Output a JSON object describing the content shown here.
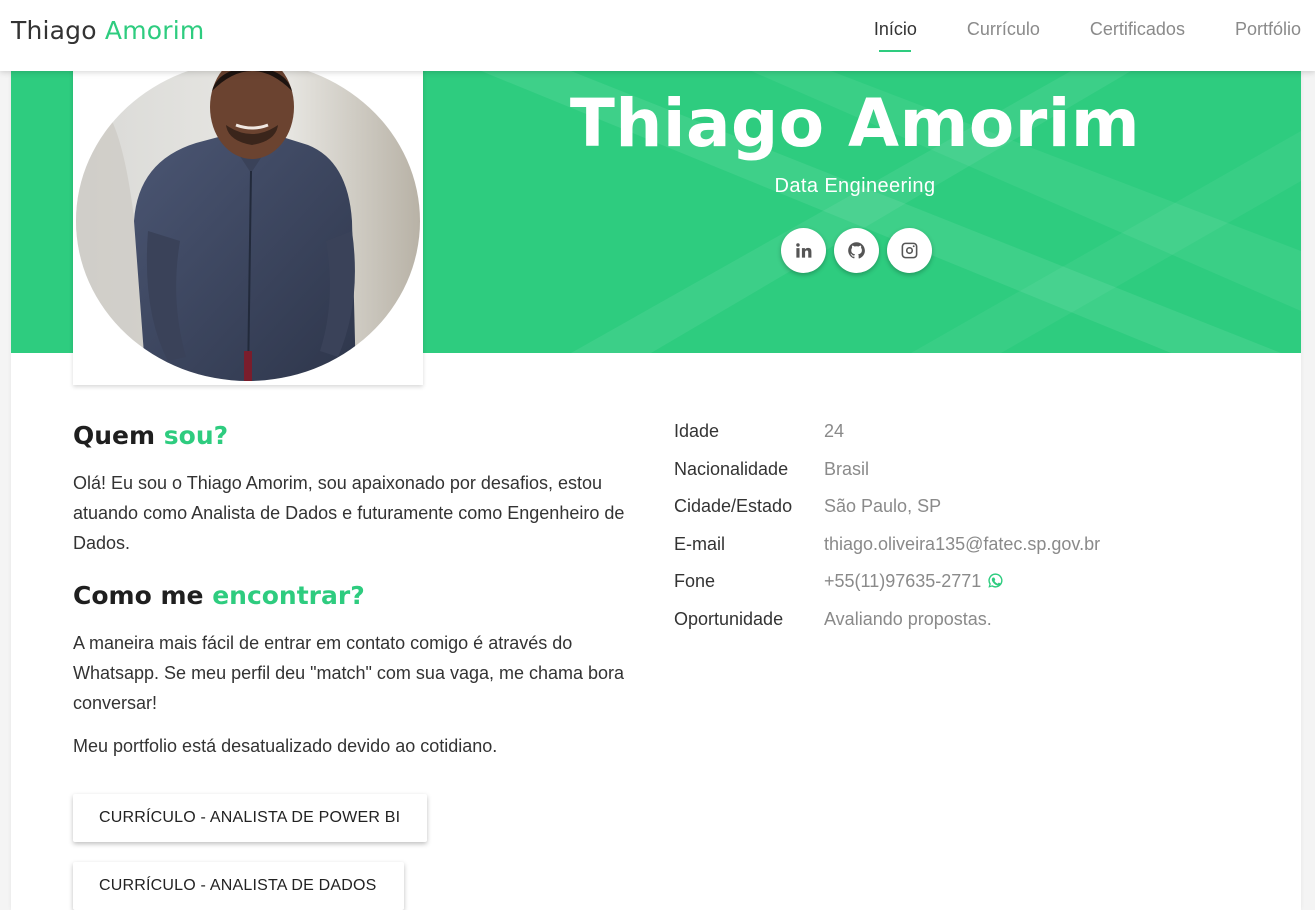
{
  "nav": {
    "brand_first": "Thiago",
    "brand_second": "Amorim",
    "links": [
      {
        "label": "Início",
        "active": true
      },
      {
        "label": "Currículo",
        "active": false
      },
      {
        "label": "Certificados",
        "active": false
      },
      {
        "label": "Portfólio",
        "active": false
      }
    ]
  },
  "hero": {
    "name": "Thiago Amorim",
    "role": "Data Engineering",
    "socials": [
      {
        "name": "linkedin-icon"
      },
      {
        "name": "github-icon"
      },
      {
        "name": "instagram-icon"
      }
    ]
  },
  "about": {
    "title_start": "Quem",
    "title_accent": "sou?",
    "text": "Olá! Eu sou o Thiago Amorim, sou apaixonado por desafios, estou atuando como Analista de Dados e futuramente como Engenheiro de Dados."
  },
  "contact": {
    "title_start": "Como me",
    "title_accent": "encontrar?",
    "text": "A maneira mais fácil de entrar em contato comigo é através do Whatsapp. Se meu perfil deu \"match\" com sua vaga, me chama bora conversar!",
    "note": "Meu portfolio está desatualizado devido ao cotidiano."
  },
  "buttons": {
    "cv_powerbi": "CURRÍCULO - ANALISTA DE POWER BI",
    "cv_dados": "CURRÍCULO - ANALISTA DE DADOS"
  },
  "info": {
    "idade": {
      "label": "Idade",
      "value": "24"
    },
    "nacionalidade": {
      "label": "Nacionalidade",
      "value": "Brasil"
    },
    "cidade": {
      "label": "Cidade/Estado",
      "value": "São Paulo, SP"
    },
    "email": {
      "label": "E-mail",
      "value": "thiago.oliveira135@fatec.sp.gov.br"
    },
    "fone": {
      "label": "Fone",
      "value": "+55(11)97635-2771"
    },
    "oportunidade": {
      "label": "Oportunidade",
      "value": "Avaliando propostas."
    }
  },
  "colors": {
    "accent": "#2ecc7f",
    "text": "#333333",
    "muted": "#8a8a8a"
  }
}
